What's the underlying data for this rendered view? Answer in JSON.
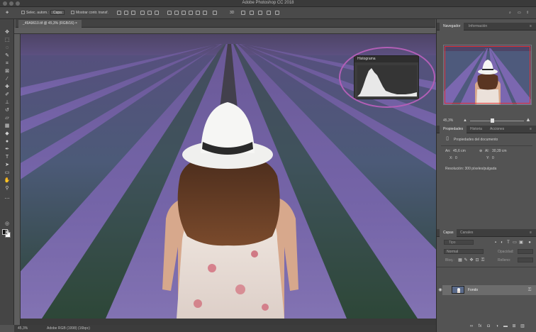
{
  "window": {
    "title": "Adobe Photoshop CC 2018"
  },
  "options_bar": {
    "auto_select_label": "Selec. autom.:",
    "auto_select_value": "Capa",
    "transform_controls_label": "Mostrar contr. transf."
  },
  "document": {
    "tab_label": "_49A9610.tif @ 45,3% (RGB/16)"
  },
  "histogram": {
    "title": "Histograma"
  },
  "panels": {
    "top_tabs": [
      "Navegador",
      "Información"
    ],
    "navigator_zoom": "45,3%",
    "properties_tabs": [
      "Propiedades",
      "Historia",
      "Acciones"
    ],
    "properties_title": "Propiedades del documento",
    "width_label": "An:",
    "width_value": "45,6 cm",
    "height_label": "Al:",
    "height_value": "30,39 cm",
    "x_label": "X:",
    "x_value": "0",
    "y_label": "Y:",
    "y_value": "0",
    "resolution": "Resolución: 300 píxeles/pulgada",
    "layers_tabs": [
      "Capas",
      "Canales"
    ],
    "kind_placeholder": "Tipo",
    "blend_mode": "Normal",
    "opacity_label": "Opacidad:",
    "lock_label": "Bloq.:",
    "fill_label": "Relleno:",
    "layer_name": "Fondo"
  },
  "status": {
    "zoom": "45,3%",
    "info": "Adobe RGB (1998) (16bpc)"
  },
  "colors": {
    "accent_ring": "#b25fb6",
    "lavender": "#6e5a9c",
    "field_green": "#2f4a3a"
  }
}
